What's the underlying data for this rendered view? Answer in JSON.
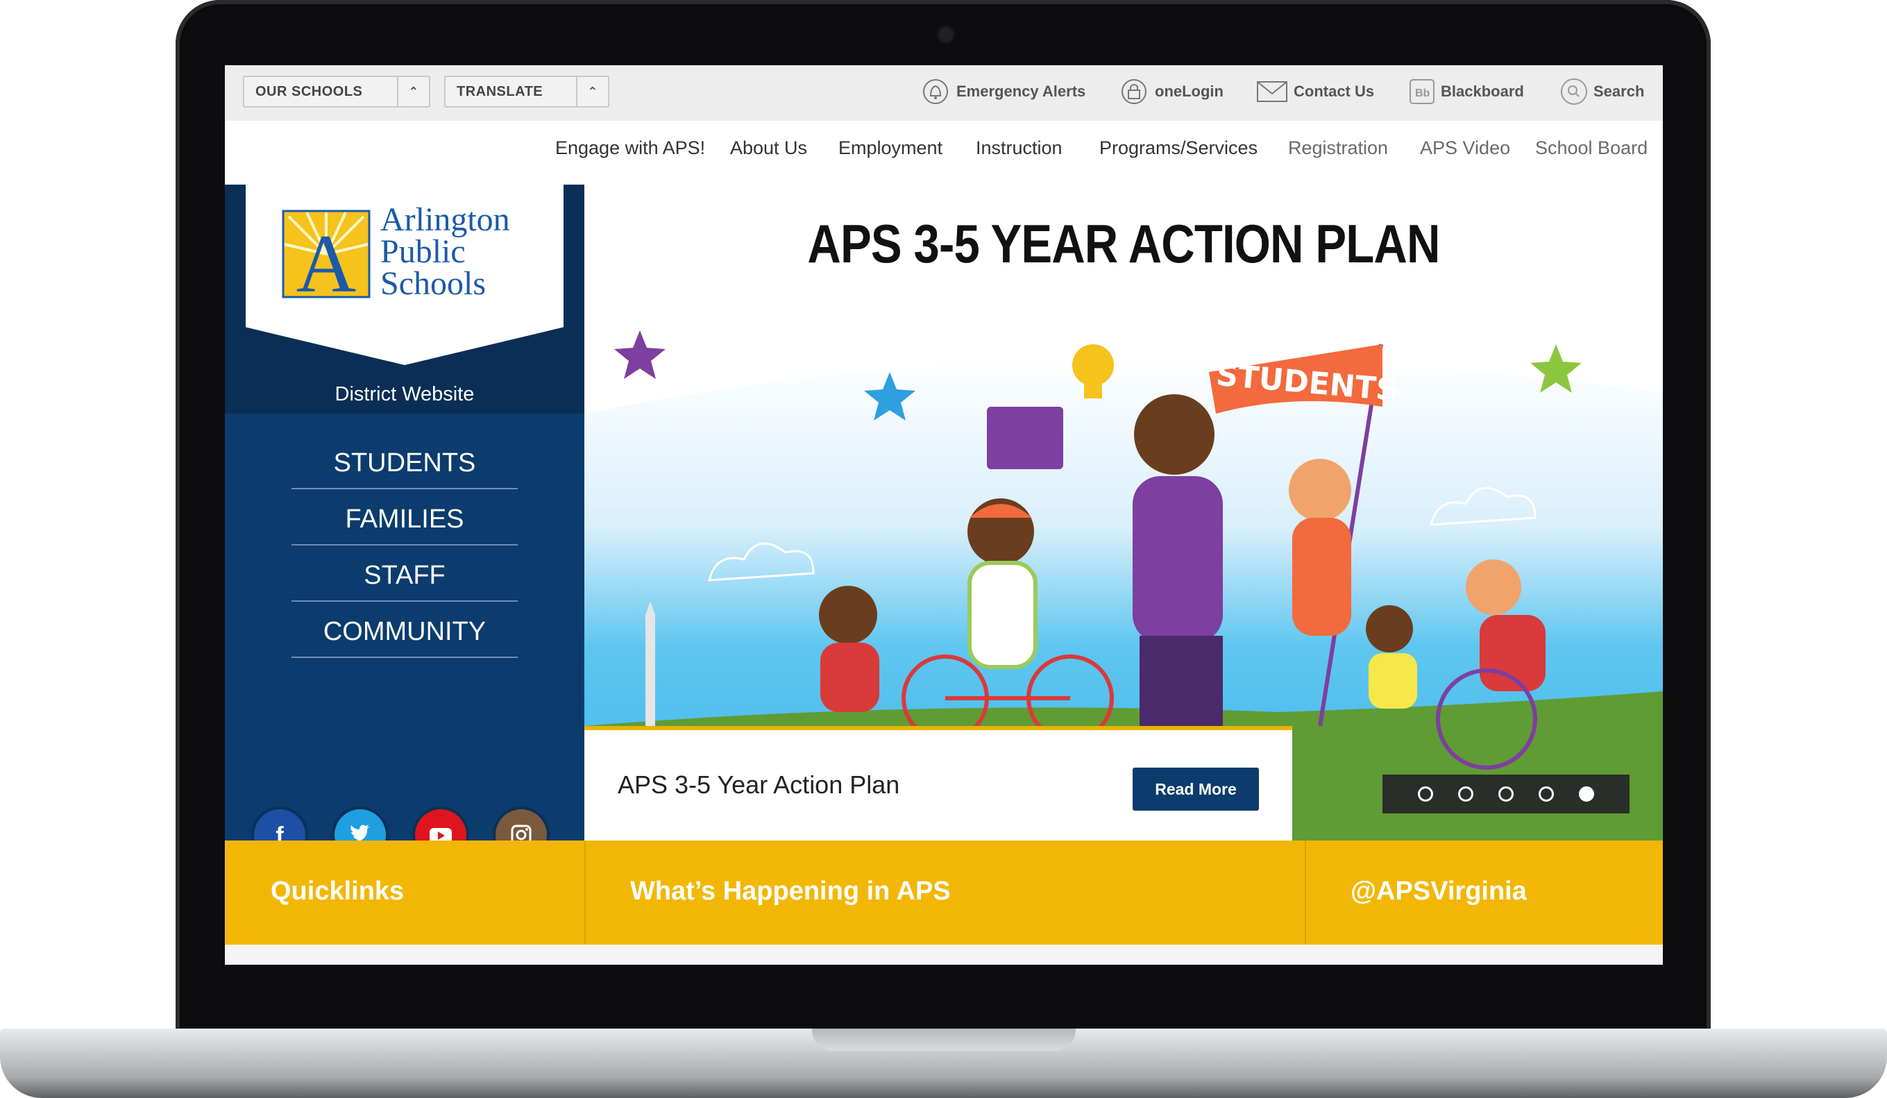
{
  "utility_bar": {
    "our_schools": "OUR SCHOOLS",
    "translate": "TRANSLATE",
    "links": {
      "emergency": "Emergency Alerts",
      "onelogin": "oneLogin",
      "contact": "Contact Us",
      "blackboard": "Blackboard",
      "search": "Search"
    }
  },
  "nav": {
    "items": [
      "Engage with APS!",
      "About Us",
      "Employment",
      "Instruction",
      "Programs/Services",
      "Registration",
      "APS Video",
      "School Board"
    ]
  },
  "logo": {
    "line1": "Arlington",
    "line2": "Public",
    "line3": "Schools",
    "emblem_letter": "A"
  },
  "sidebar": {
    "district_label": "District Website",
    "audiences": [
      "STUDENTS",
      "FAMILIES",
      "STAFF",
      "COMMUNITY"
    ],
    "social": [
      "facebook-icon",
      "twitter-icon",
      "youtube-icon",
      "instagram-icon"
    ]
  },
  "hero": {
    "title": "APS 3-5 YEAR ACTION PLAN",
    "banner_flag": "STUDENTS",
    "caption": "APS 3-5 Year Action Plan",
    "read_more": "Read More",
    "slides_total": 5,
    "active_slide": 5
  },
  "bottom": {
    "quicklinks": "Quicklinks",
    "happening": "What’s Happening in APS",
    "twitter_handle": "@APSVirginia"
  },
  "colors": {
    "navy": "#0b3c6d",
    "navy_dark": "#0a2e55",
    "yellow": "#f2b705",
    "logo_blue": "#1b5aa8"
  }
}
